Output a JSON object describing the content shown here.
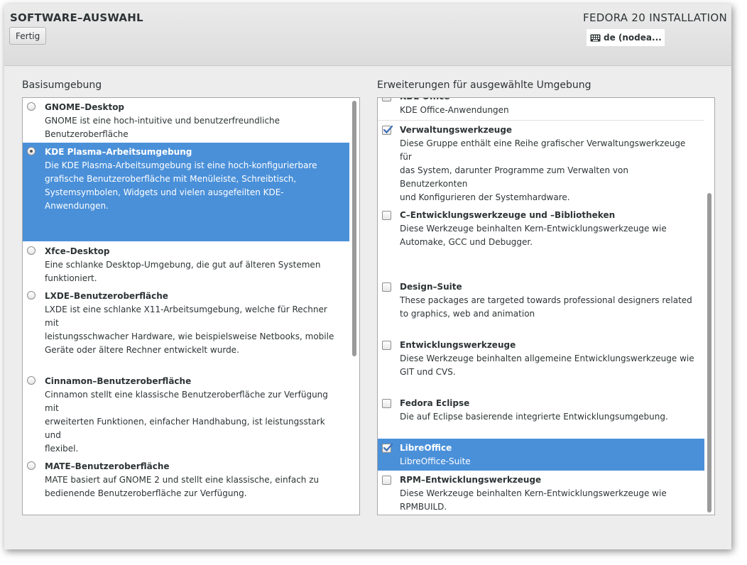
{
  "header": {
    "title": "SOFTWARE–AUSWAHL",
    "done_label": "Fertig",
    "product": "FEDORA 20 INSTALLATION",
    "keyboard_layout": "de (nodea..."
  },
  "base": {
    "label": "Basisumgebung",
    "items": [
      {
        "title": "GNOME–Desktop",
        "desc": [
          "GNOME ist eine hoch-intuitive und benutzerfreundliche",
          "Benutzeroberfläche"
        ],
        "selected": false
      },
      {
        "title": "KDE Plasma–Arbeitsumgebung",
        "desc": [
          "Die KDE Plasma-Arbeitsumgebung ist eine hoch-konfigurierbare",
          "grafische Benutzeroberfläche mit Menüleiste, Schreibtisch,",
          "Systemsymbolen, Widgets und vielen ausgefeilten KDE-Anwendungen."
        ],
        "selected": true
      },
      {
        "title": "Xfce–Desktop",
        "desc": [
          "Eine schlanke Desktop-Umgebung, die gut auf älteren Systemen",
          "funktioniert."
        ],
        "selected": false
      },
      {
        "title": "LXDE–Benutzeroberfläche",
        "desc": [
          "LXDE ist eine schlanke X11-Arbeitsumgebung, welche für Rechner mit",
          "leistungsschwacher Hardware, wie beispielsweise Netbooks, mobile",
          "Geräte oder ältere Rechner entwickelt wurde."
        ],
        "selected": false
      },
      {
        "title": "Cinnamon–Benutzeroberfläche",
        "desc": [
          "Cinnamon stellt eine klassische Benutzeroberfläche zur Verfügung mit",
          "erweiterten Funktionen, einfacher Handhabung, ist leistungsstark und",
          "flexibel."
        ],
        "selected": false
      },
      {
        "title": "MATE–Benutzeroberfläche",
        "desc": [
          "MATE basiert auf GNOME 2 und stellt eine klassische, einfach zu",
          "bedienende Benutzeroberfläche zur Verfügung."
        ],
        "selected": false
      }
    ]
  },
  "addons": {
    "label": "Erweiterungen für ausgewählte Umgebung",
    "items": [
      {
        "title": "KDE Office",
        "desc": [
          "KDE Office-Anwendungen"
        ],
        "checked": false,
        "selected": false
      },
      {
        "title": "Verwaltungswerkzeuge",
        "desc": [
          "Diese Gruppe enthält eine Reihe grafischer Verwaltungswerkzeuge für",
          "das System, darunter Programme zum Verwalten von Benutzerkonten",
          "und Konfigurieren der Systemhardware."
        ],
        "checked": true,
        "selected": false
      },
      {
        "title": "C–Entwicklungswerkzeuge und –Bibliotheken",
        "desc": [
          "Diese Werkzeuge beinhalten Kern-Entwicklungswerkzeuge wie",
          "Automake, GCC und Debugger."
        ],
        "checked": false,
        "selected": false
      },
      {
        "title": "Design–Suite",
        "desc": [
          "These packages are targeted towards professional designers related",
          "to graphics, web and animation"
        ],
        "checked": false,
        "selected": false
      },
      {
        "title": "Entwicklungswerkzeuge",
        "desc": [
          "Diese Werkzeuge beinhalten allgemeine Entwicklungswerkzeuge wie",
          "GIT und CVS."
        ],
        "checked": false,
        "selected": false
      },
      {
        "title": "Fedora Eclipse",
        "desc": [
          "Die auf Eclipse basierende integrierte Entwicklungsumgebung."
        ],
        "checked": false,
        "selected": false
      },
      {
        "title": "LibreOffice",
        "desc": [
          "LibreOffice-Suite"
        ],
        "checked": true,
        "selected": true
      },
      {
        "title": "RPM–Entwicklungswerkzeuge",
        "desc": [
          "Diese Werkzeuge beinhalten Kern-Entwicklungswerkzeuge wie",
          "RPMBUILD."
        ],
        "checked": false,
        "selected": false
      }
    ]
  },
  "colors": {
    "selection": "#4a90d9",
    "window_bg": "#ededed"
  }
}
